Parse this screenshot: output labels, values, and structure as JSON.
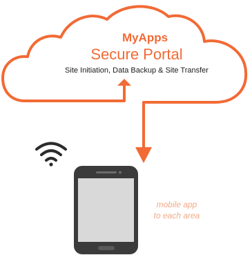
{
  "cloud": {
    "brand": "MyApps",
    "title": "Secure Portal",
    "subtitle": "Site Initiation, Data Backup & Site Transfer"
  },
  "note": {
    "line1": "mobile app",
    "line2": "to each area"
  },
  "colors": {
    "accent": "#f26a35",
    "note": "#f4a987",
    "phone_body": "#3b3b3b",
    "phone_screen": "#d9d9d9",
    "wifi": "#2b2b2b"
  },
  "icons": {
    "connectivity": "wifi-icon",
    "device": "smartphone-icon",
    "flow_up": "arrow-up-icon",
    "flow_down": "arrow-down-icon"
  }
}
